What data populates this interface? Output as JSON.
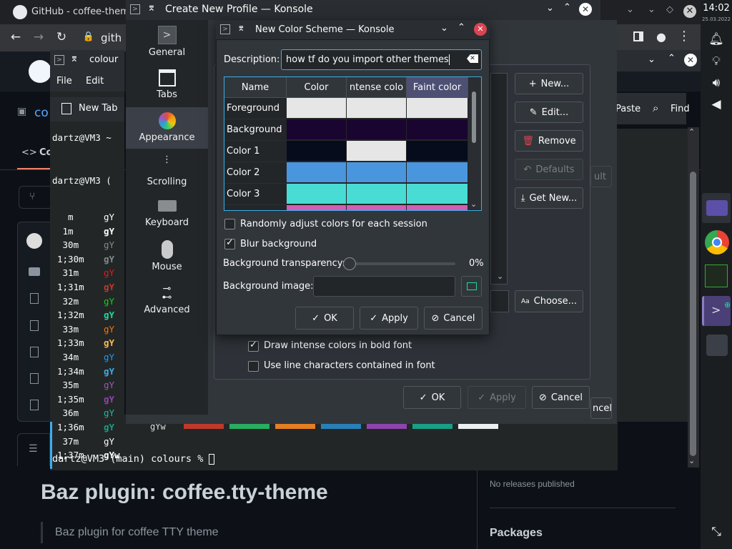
{
  "browser": {
    "tab_title": "GitHub - coffee-theme",
    "address": "gith",
    "repo_short": "co",
    "code_tab": "Co",
    "branch_icon": "branch-icon",
    "paste_label": "Paste",
    "find_label": "Find",
    "readme_title": "Baz plugin: coffee.tty-theme",
    "readme_quote": "Baz plugin for coffee TTY theme",
    "releases_text": "No releases published",
    "packages_heading": "Packages"
  },
  "panel": {
    "time": "14:02",
    "date": "25.03.2022"
  },
  "terminal": {
    "title": "colour",
    "menu": [
      "File",
      "Edit"
    ],
    "new_tab": "New Tab",
    "prompt1": "dartz@VM3 ~",
    "prompt2": "dartz@VM3 (",
    "rows": [
      {
        "a": "  m",
        "b": "gY"
      },
      {
        "a": " 1m",
        "b": "gY"
      },
      {
        "a": " 30m",
        "b": "gY"
      },
      {
        "a": "1;30m",
        "b": "gY"
      },
      {
        "a": " 31m",
        "b": "gY"
      },
      {
        "a": "1;31m",
        "b": "gY"
      },
      {
        "a": " 32m",
        "b": "gY"
      },
      {
        "a": "1;32m",
        "b": "gY"
      },
      {
        "a": " 33m",
        "b": "gY"
      },
      {
        "a": "1;33m",
        "b": "gY"
      },
      {
        "a": " 34m",
        "b": "gY"
      },
      {
        "a": "1;34m",
        "b": "gY"
      },
      {
        "a": " 35m",
        "b": "gY"
      },
      {
        "a": "1;35m",
        "b": "gY"
      },
      {
        "a": " 36m",
        "b": "gY"
      },
      {
        "a": "1;36m",
        "b": "gY"
      },
      {
        "a": " 37m",
        "b": "gY"
      },
      {
        "a": "1;37m",
        "b": "gYw"
      }
    ],
    "row_colors": [
      "#fcfcfc",
      "#ffffff",
      "#7f8c8d",
      "#7f8c8d",
      "#ed1515",
      "#c0392b",
      "#11d116",
      "#1cdc9a",
      "#f67400",
      "#fdbc4b",
      "#1d99f3",
      "#3daee9",
      "#9b59b6",
      "#8e44ad",
      "#1abc9c",
      "#16a085",
      "#fcfcfc",
      "#ffffff"
    ],
    "final_prompt": "dartz@VM3 (main) colours % "
  },
  "profile_window": {
    "title": "Create New Profile — Konsole",
    "sidebar": [
      {
        "label": "General",
        "icon": "terminal-icon"
      },
      {
        "label": "Tabs",
        "icon": "tabs-icon"
      },
      {
        "label": "Appearance",
        "icon": "appearance-icon"
      },
      {
        "label": "Scrolling",
        "icon": "scrolling-icon"
      },
      {
        "label": "Keyboard",
        "icon": "keyboard-icon"
      },
      {
        "label": "Mouse",
        "icon": "mouse-icon"
      },
      {
        "label": "Advanced",
        "icon": "advanced-icon"
      }
    ],
    "buttons": {
      "new": "New...",
      "edit": "Edit...",
      "remove": "Remove",
      "defaults": "Defaults",
      "get_new": "Get New...",
      "choose": "Choose...",
      "ok": "OK",
      "apply": "Apply",
      "cancel": "Cancel",
      "default_partial": "ult",
      "cancel_partial": "ncel"
    },
    "options": {
      "bold": "Draw intense colors in bold font",
      "line_chars": "Use line characters contained in font"
    }
  },
  "color_scheme_dialog": {
    "title": "New Color Scheme — Konsole",
    "description_label": "Description:",
    "description_value": "how tf do you import other themes",
    "columns": [
      "Name",
      "Color",
      "ntense colo",
      "Faint color"
    ],
    "rows": [
      {
        "name": "Foreground",
        "colors": [
          "#e6e6e6",
          "#e6e6e6",
          "#e6e6e6"
        ]
      },
      {
        "name": "Background",
        "colors": [
          "#1a0530",
          "#1a0530",
          "#1a0530"
        ]
      },
      {
        "name": "Color 1",
        "colors": [
          "#060c1c",
          "#e6e6e6",
          "#060c1c"
        ]
      },
      {
        "name": "Color 2",
        "colors": [
          "#4a96de",
          "#4a96de",
          "#4a96de"
        ]
      },
      {
        "name": "Color 3",
        "colors": [
          "#49dcd4",
          "#49dcd4",
          "#49dcd4"
        ]
      },
      {
        "name": "",
        "colors": [
          "#d05fb5",
          "#d05fb5",
          "#d05fb5"
        ]
      }
    ],
    "random_label": "Randomly adjust colors for each session",
    "random_checked": false,
    "blur_label": "Blur background",
    "blur_checked": true,
    "transparency_label": "Background transparency:",
    "transparency_value": "0%",
    "transparency_fraction": 0,
    "bgimage_label": "Background image:",
    "ok": "OK",
    "apply": "Apply",
    "cancel": "Cancel"
  },
  "colors": {
    "accent": "#3daee9",
    "window_bg": "#31363b",
    "titlebar_bg": "#2a2e32",
    "close_red": "#da4453"
  }
}
